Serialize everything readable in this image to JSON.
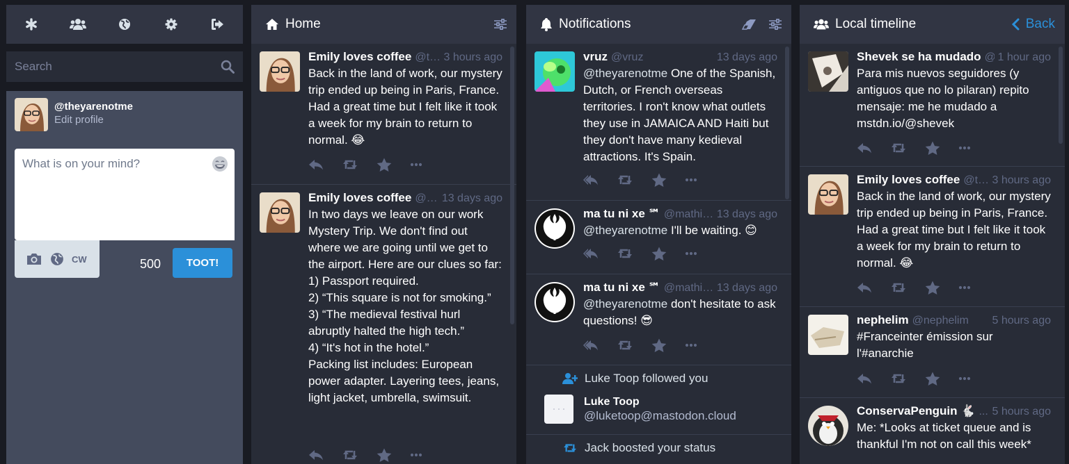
{
  "drawer": {
    "nav": [
      {
        "icon": "asterisk-icon",
        "label": "Getting started"
      },
      {
        "icon": "users-icon",
        "label": "Local timeline"
      },
      {
        "icon": "globe-icon",
        "label": "Federated timeline"
      },
      {
        "icon": "gear-icon",
        "label": "Preferences"
      },
      {
        "icon": "sign-out-icon",
        "label": "Logout"
      }
    ],
    "search_placeholder": "Search",
    "account": {
      "handle": "@theyarenotme",
      "edit_profile": "Edit profile"
    },
    "compose": {
      "placeholder": "What is on your mind?",
      "cw_label": "CW",
      "char_count": "500",
      "toot_label": "TOOT!"
    }
  },
  "home": {
    "title": "Home",
    "statuses": [
      {
        "name": "Emily loves coffee",
        "acct": "@th...",
        "time": "3 hours ago",
        "text": "Back in the land of work, our mystery trip ended up being in Paris, France. Had a great time but I felt like it took a week for my brain to return to normal. 😂"
      },
      {
        "name": "Emily loves coffee",
        "acct": "@th...",
        "time": "13 days ago",
        "text": "In two days we leave on our work Mystery Trip. We don't find out where we are going until we get to the airport. Here are our clues so far:\n1) Passport required.\n2) “This square is not for smoking.”\n3) “The medieval festival hurl abruptly halted the high tech.”\n4) “It's hot in the hotel.”\nPacking list includes: European power adapter. Layering tees, jeans, light jacket, umbrella, swimsuit."
      }
    ]
  },
  "notifications": {
    "title": "Notifications",
    "items": [
      {
        "name": "vruz",
        "acct": "@vruz",
        "time": "13 days ago",
        "mention": "@theyarenotme",
        "text": " One of the Spanish, Dutch, or French overseas territories. I ron't know what outlets they use in JAMAICA AND Haiti but they don't have many kedieval attractions. It's Spain."
      },
      {
        "name": "ma tu ni xe ℠",
        "acct": "@mathias",
        "time": "13 days ago",
        "mention": "@theyarenotme",
        "text": " I'll be waiting. 😊"
      },
      {
        "name": "ma tu ni xe ℠",
        "acct": "@mathias",
        "time": "13 days ago",
        "mention": "@theyarenotme",
        "text": " don't hesitate to ask questions! 😎"
      }
    ],
    "follow": {
      "line_name": "Luke Toop",
      "line_suffix": "followed you",
      "name": "Luke Toop",
      "acct": "@luketoop@mastodon.cloud"
    },
    "boost": {
      "line_name": "Jack",
      "line_suffix": "boosted your status"
    }
  },
  "local": {
    "title": "Local timeline",
    "back_label": "Back",
    "statuses": [
      {
        "name": "Shevek se ha mudado",
        "acct": "@...",
        "time": "1 hour ago",
        "text": "Para mis nuevos seguidores (y antiguos que no lo pilaran) repito mensaje: me he mudado a mstdn.io/@shevek"
      },
      {
        "name": "Emily loves coffee",
        "acct": "@th...",
        "time": "3 hours ago",
        "text": "Back in the land of work, our mystery trip ended up being in Paris, France. Had a great time but I felt like it took a week for my brain to return to normal. 😂"
      },
      {
        "name": "nephelim",
        "acct": "@nephelim",
        "time": "5 hours ago",
        "text": "#Franceinter émission sur l'#anarchie"
      },
      {
        "name": "ConservaPenguin 🐇",
        "acct": "...",
        "time": "5 hours ago",
        "text": "Me: *Looks at ticket queue and is thankful I'm not on call this week*"
      }
    ]
  },
  "colors": {
    "accent": "#2b90d9",
    "icon": "#8d9ac2",
    "action_icon": "#606984",
    "panel": "#282c37",
    "header": "#313543"
  }
}
